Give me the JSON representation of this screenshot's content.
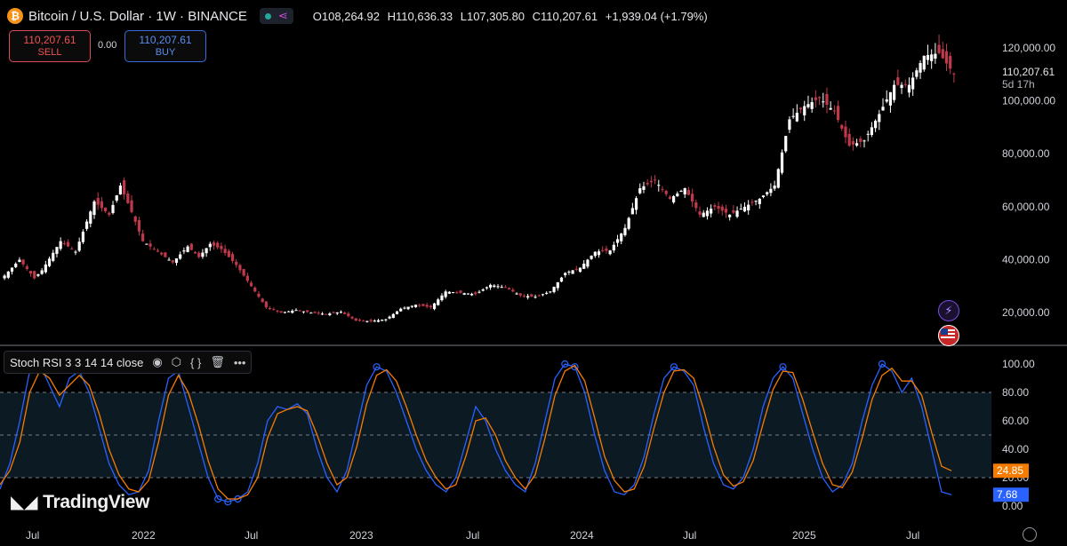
{
  "header": {
    "title": "Bitcoin / U.S. Dollar · 1W · BINANCE",
    "open": "O108,264.92",
    "high": "H110,636.33",
    "low": "L107,305.80",
    "close": "C110,207.61",
    "change": "+1,939.04 (+1.79%)"
  },
  "trade": {
    "sell_price": "110,207.61",
    "sell_label": "SELL",
    "spread": "0.00",
    "buy_price": "110,207.61",
    "buy_label": "BUY"
  },
  "indicator_legend": {
    "label": "Stoch RSI 3 3 14 14 close"
  },
  "branding": {
    "name": "TradingView"
  },
  "colors": {
    "up": "#ffffff",
    "down": "#c0394b",
    "k_line": "#2962ff",
    "d_line": "#f57c00",
    "band": "#0c1a24"
  },
  "chart_data": [
    {
      "type": "candlestick",
      "title": "Bitcoin / U.S. Dollar · 1W · BINANCE",
      "ylim": [
        8000,
        128000
      ],
      "price_ticks": [
        "20,000.00",
        "40,000.00",
        "60,000.00",
        "80,000.00",
        "100,000.00",
        "120,000.00"
      ],
      "tick_values": [
        20000,
        40000,
        60000,
        80000,
        100000,
        120000
      ],
      "current_price": "110,207.61",
      "countdown": "5d 17h",
      "x_labels": [
        "Jul",
        "2022",
        "Jul",
        "2023",
        "Jul",
        "2024",
        "Jul",
        "2025",
        "Jul"
      ],
      "anchors": [
        [
          0,
          34000
        ],
        [
          4,
          40000
        ],
        [
          8,
          33000
        ],
        [
          10,
          36000
        ],
        [
          15,
          47000
        ],
        [
          19,
          43000
        ],
        [
          24,
          62000
        ],
        [
          28,
          57000
        ],
        [
          31,
          68000
        ],
        [
          34,
          58000
        ],
        [
          37,
          47000
        ],
        [
          41,
          43000
        ],
        [
          45,
          39000
        ],
        [
          49,
          45000
        ],
        [
          52,
          41000
        ],
        [
          55,
          46000
        ],
        [
          58,
          44000
        ],
        [
          62,
          38000
        ],
        [
          66,
          30000
        ],
        [
          70,
          22000
        ],
        [
          74,
          20000
        ],
        [
          78,
          21000
        ],
        [
          82,
          20000
        ],
        [
          86,
          19500
        ],
        [
          90,
          20300
        ],
        [
          94,
          17000
        ],
        [
          98,
          16800
        ],
        [
          102,
          17500
        ],
        [
          106,
          21500
        ],
        [
          110,
          23000
        ],
        [
          114,
          22000
        ],
        [
          118,
          28000
        ],
        [
          122,
          27500
        ],
        [
          126,
          27000
        ],
        [
          130,
          30500
        ],
        [
          134,
          29500
        ],
        [
          138,
          26500
        ],
        [
          142,
          26000
        ],
        [
          146,
          28000
        ],
        [
          150,
          35000
        ],
        [
          154,
          37000
        ],
        [
          158,
          43000
        ],
        [
          162,
          43500
        ],
        [
          166,
          52000
        ],
        [
          170,
          67000
        ],
        [
          174,
          70000
        ],
        [
          178,
          63000
        ],
        [
          182,
          67000
        ],
        [
          186,
          57000
        ],
        [
          190,
          60000
        ],
        [
          194,
          57000
        ],
        [
          198,
          60000
        ],
        [
          202,
          63000
        ],
        [
          206,
          68000
        ],
        [
          210,
          93000
        ],
        [
          214,
          98000
        ],
        [
          218,
          101000
        ],
        [
          222,
          96000
        ],
        [
          226,
          83000
        ],
        [
          230,
          85000
        ],
        [
          234,
          95000
        ],
        [
          238,
          106000
        ],
        [
          242,
          106000
        ],
        [
          246,
          117000
        ],
        [
          250,
          118000
        ],
        [
          254,
          110207
        ]
      ],
      "ohlc_last": [
        108264.92,
        110636.33,
        107305.8,
        110207.61
      ]
    },
    {
      "type": "line",
      "title": "Stoch RSI 3 3 14 14 close",
      "ylim": [
        0,
        100
      ],
      "y_ticks": [
        "0.00",
        "20.00",
        "40.00",
        "60.00",
        "80.00",
        "100.00"
      ],
      "tick_values": [
        0,
        20,
        40,
        60,
        80,
        100
      ],
      "band": [
        20,
        80
      ],
      "series": [
        {
          "name": "K",
          "last": "7.68",
          "values": [
            12,
            30,
            60,
            95,
            100,
            85,
            70,
            90,
            95,
            80,
            55,
            30,
            15,
            8,
            10,
            25,
            60,
            90,
            95,
            70,
            45,
            20,
            5,
            3,
            5,
            10,
            30,
            60,
            70,
            68,
            72,
            65,
            40,
            20,
            10,
            25,
            55,
            85,
            98,
            95,
            80,
            60,
            40,
            25,
            15,
            10,
            20,
            45,
            70,
            60,
            40,
            25,
            15,
            10,
            30,
            60,
            90,
            100,
            98,
            80,
            50,
            25,
            10,
            8,
            15,
            35,
            65,
            90,
            98,
            95,
            85,
            55,
            30,
            15,
            12,
            20,
            40,
            70,
            90,
            98,
            90,
            65,
            40,
            20,
            10,
            15,
            30,
            60,
            85,
            100,
            95,
            80,
            90,
            70,
            40,
            10,
            8
          ]
        },
        {
          "name": "D",
          "last": "24.85",
          "values": [
            15,
            25,
            45,
            80,
            95,
            90,
            78,
            85,
            92,
            85,
            65,
            40,
            22,
            12,
            10,
            18,
            45,
            78,
            92,
            80,
            58,
            32,
            12,
            5,
            5,
            8,
            20,
            48,
            65,
            68,
            70,
            67,
            50,
            30,
            15,
            20,
            42,
            72,
            92,
            96,
            88,
            70,
            50,
            32,
            20,
            12,
            15,
            35,
            60,
            62,
            50,
            32,
            20,
            12,
            22,
            48,
            78,
            95,
            99,
            88,
            62,
            35,
            18,
            10,
            12,
            28,
            55,
            80,
            95,
            96,
            90,
            68,
            42,
            22,
            14,
            17,
            32,
            58,
            82,
            95,
            94,
            75,
            52,
            30,
            15,
            13,
            24,
            48,
            75,
            92,
            97,
            88,
            88,
            78,
            52,
            28,
            24.85
          ]
        }
      ]
    }
  ]
}
